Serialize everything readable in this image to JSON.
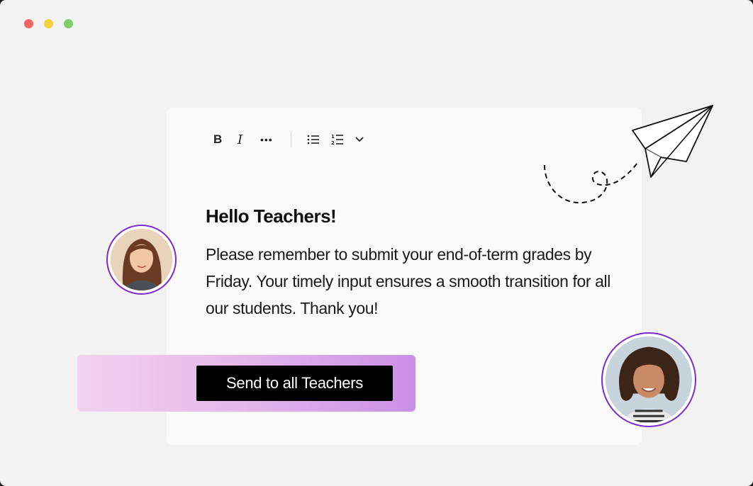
{
  "window": {
    "controls": [
      "close",
      "minimize",
      "maximize"
    ]
  },
  "toolbar": {
    "bold_label": "B",
    "italic_label": "I",
    "more_label": "•••",
    "icons": [
      "bold-icon",
      "italic-icon",
      "more-icon",
      "bulleted-list-icon",
      "numbered-list-icon",
      "chevron-down-icon"
    ]
  },
  "message": {
    "title": "Hello Teachers!",
    "body": "Please remember to submit your end-of-term grades by Friday. Your timely input ensures a smooth transition for all our students. Thank you!"
  },
  "send_button": {
    "label": "Send to all Teachers"
  },
  "colors": {
    "accent": "#7b2ccb",
    "button": "#000000",
    "gradient_start": "#f3d1ef",
    "gradient_end": "#c98fe6"
  }
}
